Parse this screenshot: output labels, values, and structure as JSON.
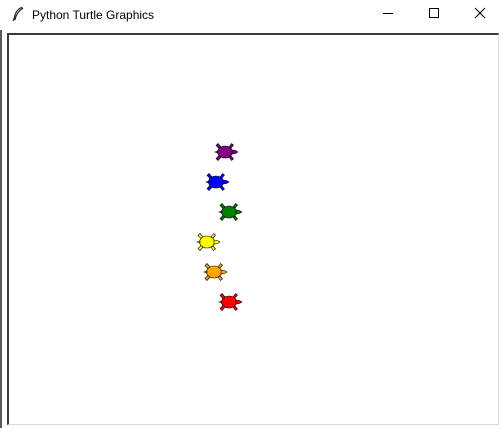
{
  "window": {
    "title": "Python Turtle Graphics",
    "icon": "feather-icon",
    "controls": [
      "minimize-icon",
      "maximize-icon",
      "close-icon"
    ]
  },
  "turtles": [
    {
      "color": "#800080",
      "shape": "turtle",
      "heading": "east"
    },
    {
      "color": "#0000ff",
      "shape": "turtle",
      "heading": "east"
    },
    {
      "color": "#008000",
      "shape": "turtle",
      "heading": "east"
    },
    {
      "color": "#ffff00",
      "shape": "turtle",
      "heading": "east"
    },
    {
      "color": "#ffa500",
      "shape": "turtle",
      "heading": "east"
    },
    {
      "color": "#ff0000",
      "shape": "turtle",
      "heading": "east"
    }
  ]
}
